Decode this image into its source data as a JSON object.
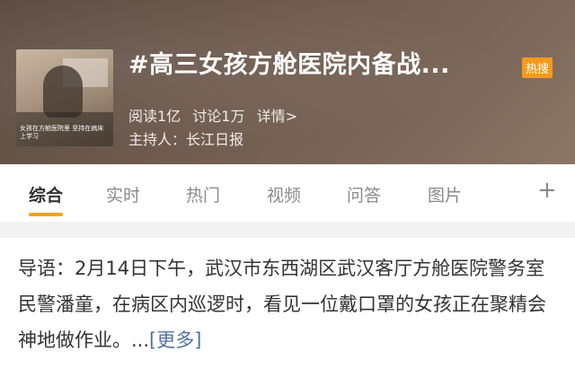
{
  "topic": {
    "title": "#高三女孩方舱医院内备战...",
    "badge": "热搜",
    "reads": "阅读1亿",
    "discussions": "讨论1万",
    "details": "详情>",
    "host": "主持人：长江日报",
    "thumbnail_caption": "女孩在方舱医院里 坚持在病床上学习"
  },
  "tabs": [
    {
      "label": "综合",
      "active": true
    },
    {
      "label": "实时",
      "active": false
    },
    {
      "label": "热门",
      "active": false
    },
    {
      "label": "视频",
      "active": false
    },
    {
      "label": "问答",
      "active": false
    },
    {
      "label": "图片",
      "active": false
    }
  ],
  "add_tab_symbol": "+",
  "intro": {
    "text": "导语：2月14日下午，武汉市东西湖区武汉客厅方舱医院警务室民警潘童，在病区内巡逻时，看见一位戴口罩的女孩正在聚精会神地做作业。...",
    "more_label": "[更多]"
  },
  "colors": {
    "accent": "#f5a21b",
    "link": "#50749e"
  }
}
